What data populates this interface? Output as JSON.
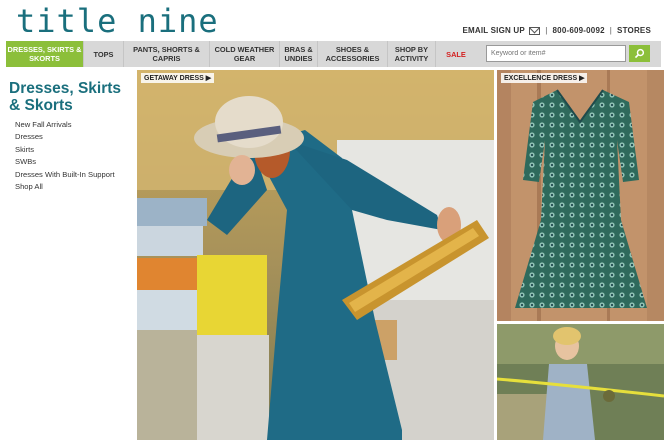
{
  "logo": "title nine",
  "utility": {
    "email_signup": "EMAIL SIGN UP",
    "phone": "800-609-0092",
    "stores": "STORES"
  },
  "nav": [
    {
      "label": "DRESSES, SKIRTS & SKORTS"
    },
    {
      "label": "TOPS"
    },
    {
      "label": "PANTS, SHORTS & CAPRIS"
    },
    {
      "label": "COLD WEATHER GEAR"
    },
    {
      "label": "BRAS & UNDIES"
    },
    {
      "label": "SHOES & ACCESSORIES"
    },
    {
      "label": "SHOP BY ACTIVITY"
    },
    {
      "label": "SALE"
    }
  ],
  "search": {
    "placeholder": "Keyword or item#"
  },
  "sidebar": {
    "title": "Dresses, Skirts & Skorts",
    "items": [
      "New Fall Arrivals",
      "Dresses",
      "Skirts",
      "SWBs",
      "Dresses With Built-In Support",
      "Shop All"
    ]
  },
  "promos": {
    "main": "GETAWAY DRESS ▶",
    "right": "EXCELLENCE DRESS ▶"
  },
  "colors": {
    "brand": "#1a6f7d",
    "accent": "#8cbf3a",
    "sale": "#d42020",
    "nav_bg": "#d8d8d8"
  }
}
